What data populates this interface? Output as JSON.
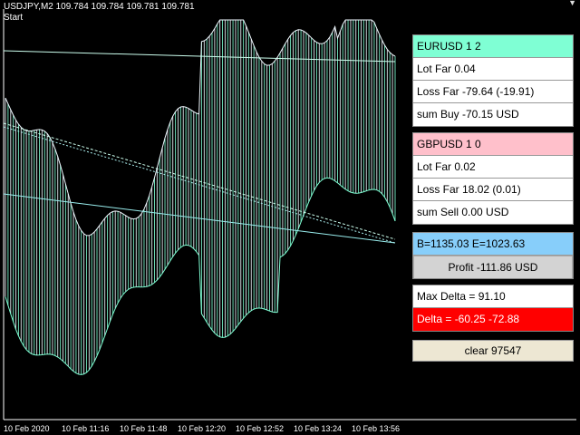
{
  "header": {
    "symbol_line": "USDJPY,M2  109.784 109.784 109.781 109.781",
    "status": "Start"
  },
  "x_axis": {
    "labels": [
      "10 Feb 2020",
      "10 Feb 11:16",
      "10 Feb 11:48",
      "10 Feb 12:20",
      "10 Feb 12:52",
      "10 Feb 13:24",
      "10 Feb 13:56"
    ]
  },
  "colors": {
    "up": "#f0f8ff",
    "down": "#7fffd4",
    "pink": "#ffc0cb",
    "blue": "#87cefa",
    "red": "#ff0000"
  },
  "panel1": {
    "title": "EURUSD 1 2",
    "lot_far": "Lot Far  0.04",
    "loss_far": "Loss Far  -79.64 (-19.91)",
    "sum": "sum Buy   -70.15 USD"
  },
  "panel2": {
    "title": "GBPUSD 1 0",
    "lot_far": "Lot Far   0.02",
    "loss_far": "Loss Far  18.02 (0.01)",
    "sum": "sum Sell   0.00 USD"
  },
  "balance": {
    "text": "B=1135.03   E=1023.63",
    "profit_button": "Profit -111.86 USD"
  },
  "delta": {
    "max": "Max Delta = 91.10",
    "current": "Delta = -60.25    -72.88"
  },
  "clear_button": "clear 97547"
}
